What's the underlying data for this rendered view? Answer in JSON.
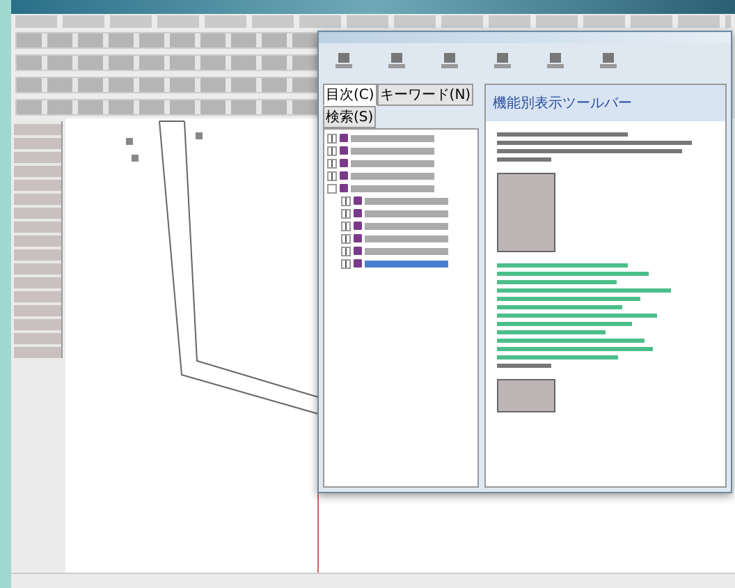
{
  "help_window": {
    "tabs": [
      {
        "label": "目次(C)",
        "selected": true
      },
      {
        "label": "キーワード(N)",
        "selected": false
      },
      {
        "label": "検索(S)",
        "selected": false
      }
    ],
    "tree": [
      {
        "expanded": false,
        "selected": false
      },
      {
        "expanded": false,
        "selected": false
      },
      {
        "expanded": false,
        "selected": false
      },
      {
        "expanded": false,
        "selected": false
      },
      {
        "expanded": true,
        "selected": false,
        "children": [
          {
            "expanded": false,
            "selected": false
          },
          {
            "expanded": false,
            "selected": false
          },
          {
            "expanded": false,
            "selected": false
          },
          {
            "expanded": false,
            "selected": false
          },
          {
            "expanded": false,
            "selected": false
          },
          {
            "expanded": false,
            "selected": true
          }
        ]
      }
    ],
    "topic": {
      "title": "機能別表示ツールバー"
    }
  }
}
